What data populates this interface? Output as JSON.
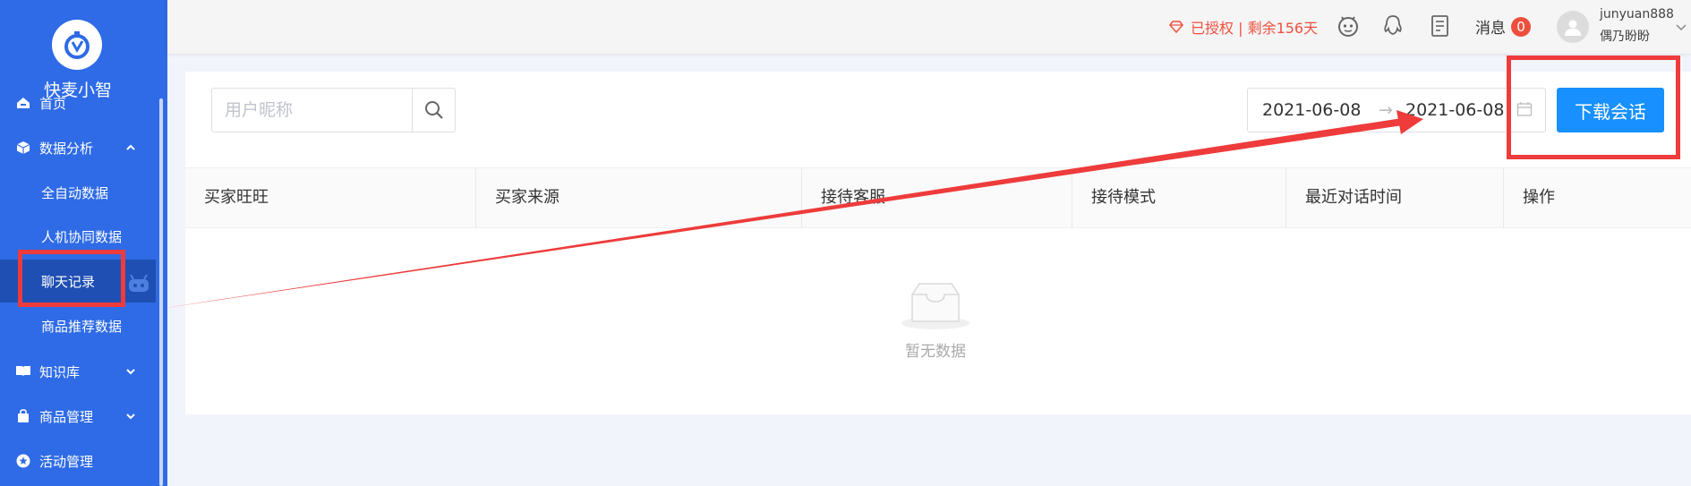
{
  "app": {
    "name": "快麦小智"
  },
  "sidebar": {
    "items": [
      {
        "label": "首页",
        "icon": "home-icon"
      },
      {
        "label": "数据分析",
        "icon": "cube-icon",
        "expanded": true
      },
      {
        "label": "全自动数据"
      },
      {
        "label": "人机协同数据"
      },
      {
        "label": "聊天记录",
        "active": true
      },
      {
        "label": "商品推荐数据"
      },
      {
        "label": "知识库",
        "icon": "book-icon"
      },
      {
        "label": "商品管理",
        "icon": "bag-icon"
      },
      {
        "label": "活动管理",
        "icon": "star-icon"
      }
    ]
  },
  "header": {
    "auth_text": "已授权 | 剩余156天",
    "messages_label": "消息",
    "messages_count": "0",
    "username": "junyuan888",
    "shop_name": "偶乃盼盼"
  },
  "toolbar": {
    "search_placeholder": "用户昵称",
    "date_start": "2021-06-08",
    "date_separator": "→",
    "date_end": "2021-06-08",
    "download_label": "下载会话"
  },
  "table": {
    "columns": [
      "买家旺旺",
      "买家来源",
      "接待客服",
      "接待模式",
      "最近对话时间",
      "操作"
    ],
    "empty_text": "暂无数据"
  },
  "colors": {
    "sidebar": "#2f6be6",
    "sidebar_active": "#1f4fb3",
    "primary": "#1890ff",
    "warning": "#ee4f3d",
    "annotation": "#ee3b3b"
  }
}
